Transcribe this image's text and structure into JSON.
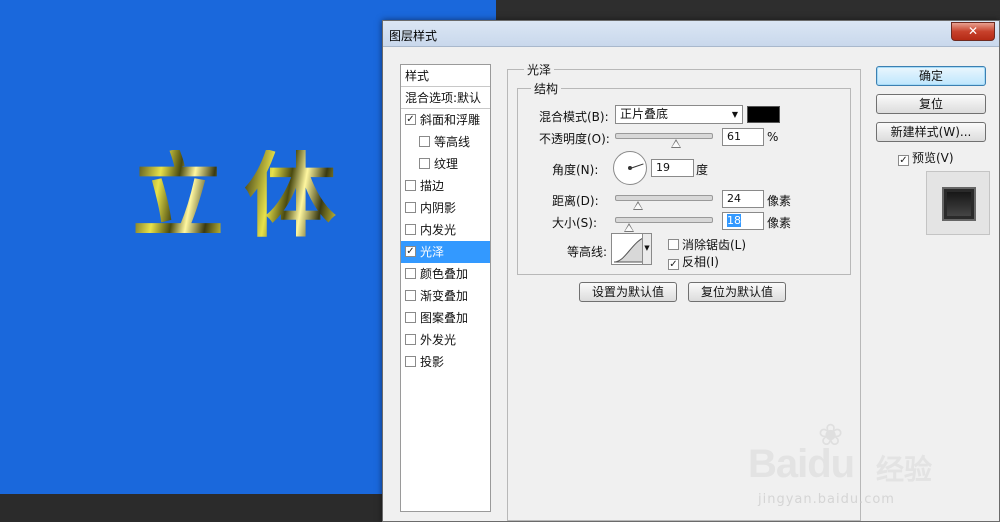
{
  "canvas": {
    "text_chars": [
      "立",
      "体"
    ]
  },
  "dialog": {
    "title": "图层样式",
    "close_label": "✕"
  },
  "left_panel": {
    "header_styles": "样式",
    "header_blend": "混合选项:默认",
    "items": [
      {
        "label": "斜面和浮雕",
        "checked": true
      },
      {
        "label": "等高线",
        "checked": false
      },
      {
        "label": "纹理",
        "checked": false
      },
      {
        "label": "描边",
        "checked": false
      },
      {
        "label": "内阴影",
        "checked": false
      },
      {
        "label": "内发光",
        "checked": false
      },
      {
        "label": "光泽",
        "checked": true,
        "selected": true
      },
      {
        "label": "颜色叠加",
        "checked": false
      },
      {
        "label": "渐变叠加",
        "checked": false
      },
      {
        "label": "图案叠加",
        "checked": false
      },
      {
        "label": "外发光",
        "checked": false
      },
      {
        "label": "投影",
        "checked": false
      }
    ]
  },
  "satin": {
    "section_title": "光泽",
    "structure_title": "结构",
    "blend_mode_label": "混合模式(B):",
    "blend_mode_value": "正片叠底",
    "blend_color": "#000000",
    "opacity_label": "不透明度(O):",
    "opacity_value": "61",
    "opacity_unit": "%",
    "opacity_fraction": 0.61,
    "angle_label": "角度(N):",
    "angle_value": "19",
    "angle_unit": "度",
    "distance_label": "距离(D):",
    "distance_value": "24",
    "distance_unit": "像素",
    "size_label": "大小(S):",
    "size_value": "18",
    "size_unit": "像素",
    "contour_label": "等高线:",
    "antialias_label": "消除锯齿(L)",
    "antialias_checked": false,
    "invert_label": "反相(I)",
    "invert_checked": true,
    "set_default_label": "设置为默认值",
    "reset_default_label": "复位为默认值"
  },
  "right_buttons": {
    "ok_label": "确定",
    "reset_label": "复位",
    "new_style_label": "新建样式(W)...",
    "preview_label": "预览(V)",
    "preview_checked": true
  },
  "watermark": {
    "brand_latin": "Bai",
    "brand_du": "du",
    "brand_cn": "经验",
    "url": "jingyan.baidu.com"
  }
}
